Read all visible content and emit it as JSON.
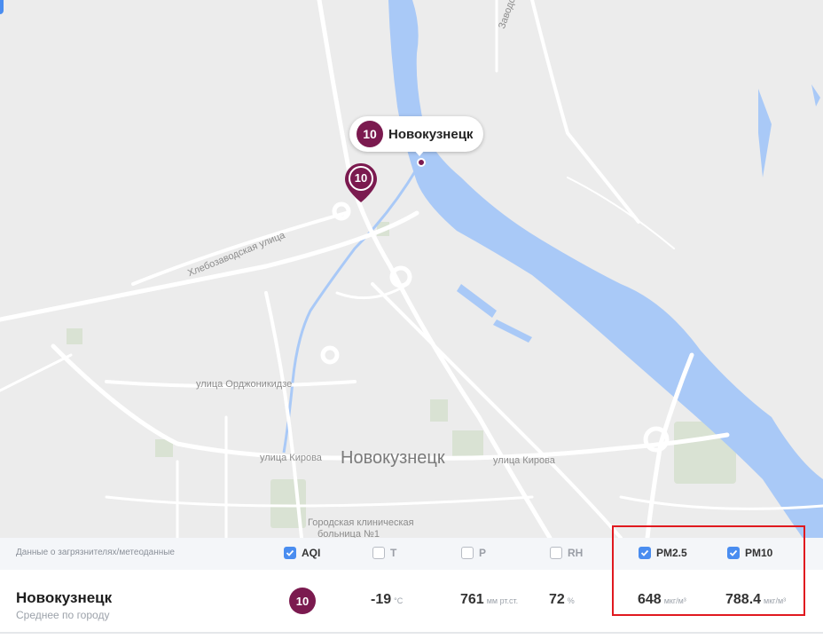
{
  "map": {
    "callout": {
      "aqi": "10",
      "city": "Новокузнецк"
    },
    "pin": {
      "aqi": "10"
    },
    "labels": {
      "zavodskoe": "Заводское шоссе",
      "hlebozavodskaya": "Хлебозаводская улица",
      "ordzhonikidze": "улица Орджоникидзе",
      "kirova_left": "улица Кирова",
      "kirova_right": "улица Кирова",
      "city": "Новокузнецк",
      "hospital_1": "Городская клиническая",
      "hospital_2": "больница №1"
    },
    "colors": {
      "land": "#ececec",
      "water": "#a9c9f7",
      "road": "#ffffff",
      "park": "#d9e2d3",
      "accent": "#7b1a4f"
    }
  },
  "panel": {
    "header": {
      "title": "Данные о загрязнителях/метеоданные",
      "columns": [
        {
          "label": "AQI",
          "checked": true
        },
        {
          "label": "T",
          "checked": false
        },
        {
          "label": "P",
          "checked": false
        },
        {
          "label": "RH",
          "checked": false
        },
        {
          "label": "PM2.5",
          "checked": true
        },
        {
          "label": "PM10",
          "checked": true
        }
      ]
    },
    "row": {
      "city": "Новокузнецк",
      "subtitle": "Среднее по городу",
      "aqi": "10",
      "temp": {
        "value": "-19",
        "unit": "°C"
      },
      "pressure": {
        "value": "761",
        "unit": "мм рт.ст."
      },
      "humidity": {
        "value": "72",
        "unit": "%"
      },
      "pm25": {
        "value": "648",
        "unit": "мкг/м³"
      },
      "pm10": {
        "value": "788.4",
        "unit": "мкг/м³"
      }
    }
  }
}
